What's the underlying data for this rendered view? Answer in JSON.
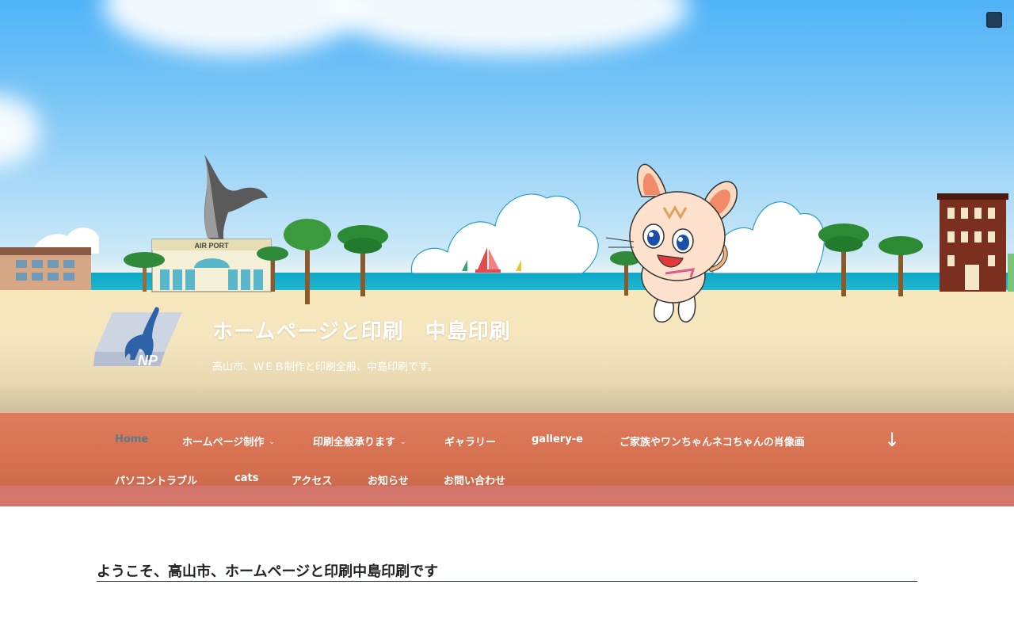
{
  "header": {
    "site_title": "ホームページと印刷　中島印刷",
    "site_description": "高山市、ＷＥＢ制作と印刷全般、中島印刷です。",
    "logo": "logo-nakajima-insatsu",
    "airport_sign": "AIR PORT",
    "corner_button_icon": "square-icon"
  },
  "nav": {
    "items": [
      {
        "label": "Home",
        "current": true
      },
      {
        "label": "ホームページ制作",
        "has_submenu": true
      },
      {
        "label": "印刷全般承ります",
        "has_submenu": true
      },
      {
        "label": "ギャラリー"
      },
      {
        "label": "gallery-e"
      },
      {
        "label": "ご家族やワンちゃんネコちゃんの肖像画"
      },
      {
        "label": "パソコントラブル"
      },
      {
        "label": "cats"
      },
      {
        "label": "アクセス"
      },
      {
        "label": "お知らせ"
      },
      {
        "label": "お問い合わせ"
      }
    ],
    "caret_glyph": "⌄",
    "scroll_down_glyph": "↓",
    "scroll_down_icon": "arrow-down-icon"
  },
  "content": {
    "welcome_heading": "ようこそ、高山市、ホームページと印刷中島印刷です"
  },
  "colors": {
    "nav_bg": "#d6714f",
    "nav_current": "#5d7b86",
    "corner_button": "#1f3d55"
  }
}
